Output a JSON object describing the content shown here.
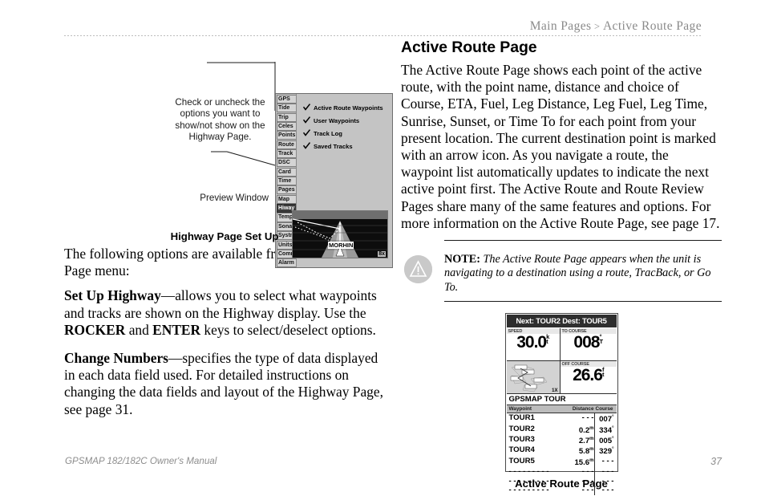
{
  "header": {
    "breadcrumb_main": "Main Pages",
    "breadcrumb_sep": ">",
    "breadcrumb_current": "Active Route Page"
  },
  "left_column": {
    "callout_checkboxes": "Check or uncheck the options you want to show/not show on the Highway Page.",
    "callout_preview": "Preview Window",
    "figure_caption": "Highway Page Set Up",
    "intro": "The following options are available from the Highway Page menu:",
    "option_1_term": "Set Up Highway",
    "option_1_text": "—allows you to select what waypoints and tracks are shown on the Highway display. Use the ",
    "option_1_key_1": "ROCKER",
    "option_1_text_2": " and ",
    "option_1_key_2": "ENTER",
    "option_1_text_3": " keys to select/deselect options.",
    "option_2_term": "Change Numbers",
    "option_2_text": "—specifies the type of data displayed in each data field used. For detailed instructions on changing the data fields and layout of the Highway Page, see page 31."
  },
  "highway_setup_device": {
    "tabs": [
      "GPS",
      "Tide",
      "Trip",
      "Celes",
      "Points",
      "Route",
      "Track",
      "DSC",
      "Card",
      "Time",
      "Pages",
      "Map",
      "Hiway",
      "Temp",
      "Sonar",
      "Systm",
      "Units",
      "Comm",
      "Alarm"
    ],
    "selected_tab": "Hiway",
    "options": [
      {
        "label": "Active Route Waypoints",
        "checked": true
      },
      {
        "label": "User Waypoints",
        "checked": true
      },
      {
        "label": "Track Log",
        "checked": true
      },
      {
        "label": "Saved Tracks",
        "checked": true
      }
    ],
    "preview_waypoint_label": "MORHIN",
    "preview_zoom": "8x"
  },
  "right_column": {
    "title": "Active Route Page",
    "paragraph_1": "The Active Route Page shows each point of the active route, with the point name, distance and choice of Course, ETA, Fuel, Leg Distance, Leg Fuel, Leg Time, Sunrise, Sunset, or Time To for each point from your present location. The current destination point is marked with an arrow icon. As you navigate a route, the waypoint list automatically updates to indicate the next active point first. The Active Route and Route Review Pages share many of the same features and options. For more information on the Active Route Page, see page 17.",
    "note_label": "NOTE:",
    "note_text": " The Active Route Page appears when the unit is navigating to a destination using a route, TracBack, or Go To.",
    "figure_caption": "Active Route Page"
  },
  "active_route_device": {
    "title_bar": "Next: TOUR2 Dest: TOUR5",
    "fields": [
      {
        "label": "SPEED",
        "value": "30.0",
        "unit_top": "k",
        "unit_bottom": "t"
      },
      {
        "label": "TO COURSE",
        "value": "008",
        "unit_top": "°",
        "unit_bottom": "T"
      },
      {
        "label": "OFF COURSE",
        "value": "26.6",
        "unit_top": "f",
        "unit_bottom": "t"
      }
    ],
    "map_zoom": "1X",
    "route_name": "GPSMAP TOUR",
    "columns": [
      "Waypoint",
      "Distance",
      "Course"
    ],
    "rows": [
      {
        "waypoint": "TOUR1",
        "distance": "- - -",
        "dist_unit": "",
        "course": "007",
        "course_unit": "°"
      },
      {
        "waypoint": "TOUR2",
        "distance": "0.2",
        "dist_unit": "m",
        "course": "334",
        "course_unit": "°"
      },
      {
        "waypoint": "TOUR3",
        "distance": "2.7",
        "dist_unit": "m",
        "course": "005",
        "course_unit": "°"
      },
      {
        "waypoint": "TOUR4",
        "distance": "5.8",
        "dist_unit": "m",
        "course": "329",
        "course_unit": "°"
      },
      {
        "waypoint": "TOUR5",
        "distance": "15.6",
        "dist_unit": "m",
        "course": "",
        "course_unit": ""
      },
      {
        "waypoint": "- - - - - - - - -",
        "distance": "- - -",
        "dist_unit": "",
        "course": "- - -",
        "course_unit": ""
      },
      {
        "waypoint": "- - - - - - - - -",
        "distance": "- - -",
        "dist_unit": "",
        "course": "- - -",
        "course_unit": ""
      },
      {
        "waypoint": "- - - - - - - - -",
        "distance": "- - -",
        "dist_unit": "",
        "course": "- - -",
        "course_unit": ""
      }
    ]
  },
  "footer": {
    "manual_title": "GPSMAP 182/182C Owner's Manual",
    "page_number": "37"
  }
}
